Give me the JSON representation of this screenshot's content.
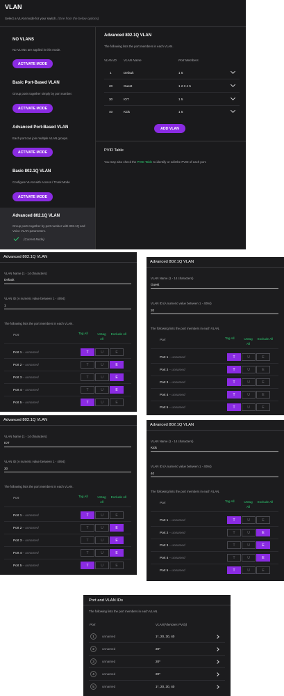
{
  "main": {
    "title": "VLAN",
    "subtitle": "Select a VLAN mode for your switch.",
    "subtitle_note": "(One from the below options)",
    "modes": [
      {
        "title": "NO VLANS",
        "desc": "No VLANs are applied in this mode.",
        "button": "ACTIVATE MODE"
      },
      {
        "title": "Basic Port-Based VLAN",
        "desc": "Group ports together simply by port number.",
        "button": "ACTIVATE MODE"
      },
      {
        "title": "Advanced Port-Based VLAN",
        "desc": "Each port can join multiple VLAN groups.",
        "button": "ACTIVATE MODE"
      },
      {
        "title": "Basic 802.1Q VLAN",
        "desc": "Configure VLAN with Access / Trunk Mode",
        "button": "ACTIVATE MODE"
      }
    ],
    "current": {
      "title": "Advanced 802.1Q VLAN",
      "desc": "Group ports together by port number with 802.1Q and Voice VLAN parameters.",
      "status": "(Current Mode)"
    },
    "right": {
      "title": "Advanced 802.1Q VLAN",
      "desc": "The following lists the port members in each VLAN.",
      "col_id": "VLAN ID",
      "col_name": "VLAN Name",
      "col_members": "Port Members",
      "rows": [
        {
          "id": "1",
          "name": "Default",
          "members": "1 5"
        },
        {
          "id": "20",
          "name": "Guest",
          "members": "1 2 3 4 5"
        },
        {
          "id": "30",
          "name": "IOT",
          "members": "1 5"
        },
        {
          "id": "40",
          "name": "Kids",
          "members": "1 5"
        }
      ],
      "add_button": "ADD VLAN",
      "pvid_title": "PVID Table",
      "pvid_pre": "You may also check the",
      "pvid_link": "PVID Table",
      "pvid_post": "to identify or edit the PVID of each port."
    }
  },
  "edit_panels": [
    {
      "title": "Advanced 802.1Q VLAN",
      "name_label": "VLAN Name (1 - 14 characters)",
      "name_value": "Default",
      "id_label": "VLAN ID (A numeric value between 1 - 4094)",
      "id_value": "1",
      "list_desc": "The following lists the port members in each VLAN.",
      "col_port": "Port",
      "col_tag": "Tag All",
      "col_untag": "Untag All",
      "col_exclude": "Exclude All",
      "ports": [
        {
          "label": "Port 1",
          "name": "unnamed",
          "state": "T"
        },
        {
          "label": "Port 2",
          "name": "unnamed",
          "state": "E"
        },
        {
          "label": "Port 3",
          "name": "unnamed",
          "state": "E"
        },
        {
          "label": "Port 4",
          "name": "unnamed",
          "state": "E"
        },
        {
          "label": "Port 5",
          "name": "unnamed",
          "state": "T"
        }
      ]
    },
    {
      "title": "Advanced 802.1Q VLAN",
      "name_label": "VLAN Name (1 - 14 characters)",
      "name_value": "Guest",
      "id_label": "VLAN ID (A numeric value between 1 - 4094)",
      "id_value": "20",
      "list_desc": "The following lists the port members in each VLAN.",
      "col_port": "Port",
      "col_tag": "Tag All",
      "col_untag": "Untag All",
      "col_exclude": "Exclude All",
      "ports": [
        {
          "label": "Port 1",
          "name": "unnamed",
          "state": "T"
        },
        {
          "label": "Port 2",
          "name": "unnamed",
          "state": "T"
        },
        {
          "label": "Port 3",
          "name": "unnamed",
          "state": "T"
        },
        {
          "label": "Port 4",
          "name": "unnamed",
          "state": "T"
        },
        {
          "label": "Port 5",
          "name": "unnamed",
          "state": "T"
        }
      ]
    },
    {
      "title": "Advanced 802.1Q VLAN",
      "name_label": "VLAN Name (1 - 14 characters)",
      "name_value": "IOT",
      "id_label": "VLAN ID (A numeric value between 1 - 4094)",
      "id_value": "30",
      "list_desc": "The following lists the port members in each VLAN.",
      "col_port": "Port",
      "col_tag": "Tag All",
      "col_untag": "Untag All",
      "col_exclude": "Exclude All",
      "ports": [
        {
          "label": "Port 1",
          "name": "unnamed",
          "state": "T"
        },
        {
          "label": "Port 2",
          "name": "unnamed",
          "state": "E"
        },
        {
          "label": "Port 3",
          "name": "unnamed",
          "state": "E"
        },
        {
          "label": "Port 4",
          "name": "unnamed",
          "state": "E"
        },
        {
          "label": "Port 5",
          "name": "unnamed",
          "state": "T"
        }
      ]
    },
    {
      "title": "Advanced 802.1Q VLAN",
      "name_label": "VLAN Name (1 - 14 characters)",
      "name_value": "Kids",
      "id_label": "VLAN ID (A numeric value between 1 - 4094)",
      "id_value": "40",
      "list_desc": "The following lists the port members in each VLAN.",
      "col_port": "Port",
      "col_tag": "Tag All",
      "col_untag": "Untag All",
      "col_exclude": "Exclude All",
      "ports": [
        {
          "label": "Port 1",
          "name": "unnamed",
          "state": "T"
        },
        {
          "label": "Port 2",
          "name": "unnamed",
          "state": "E"
        },
        {
          "label": "Port 3",
          "name": "unnamed",
          "state": "E"
        },
        {
          "label": "Port 4",
          "name": "unnamed",
          "state": "E"
        },
        {
          "label": "Port 5",
          "name": "unnamed",
          "state": "T"
        }
      ]
    }
  ],
  "pvid_panel": {
    "title": "Port and VLAN IDs",
    "desc": "The following lists the port members in each VLAN.",
    "col_port": "Port",
    "col_vlan": "VLAN(*denotes PVID)",
    "rows": [
      {
        "num": "1",
        "name": "unnamed",
        "vlans": "1*, 20, 30, 40"
      },
      {
        "num": "2",
        "name": "unnamed",
        "vlans": "20*"
      },
      {
        "num": "3",
        "name": "unnamed",
        "vlans": "20*"
      },
      {
        "num": "4",
        "name": "unnamed",
        "vlans": "20*"
      },
      {
        "num": "5",
        "name": "unnamed",
        "vlans": "1*, 20, 30, 40"
      }
    ]
  },
  "colors": {
    "accent": "#8a2be2",
    "panel": "#1c1c1e",
    "check": "#2ecc71"
  }
}
